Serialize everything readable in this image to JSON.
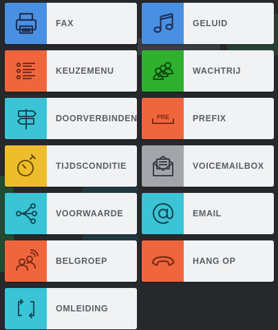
{
  "colors": {
    "blue": "#4a90e2",
    "orange": "#f0663c",
    "green": "#2fb12f",
    "teal": "#3bc3d6",
    "yellow": "#eebd2c",
    "gray": "#a3a5ab",
    "tile_bg": "#f1f2f3",
    "label": "#5b5e63"
  },
  "blocks": [
    {
      "label": "FAX",
      "icon": "fax-icon",
      "color": "blue"
    },
    {
      "label": "GELUID",
      "icon": "music-note-icon",
      "color": "blue"
    },
    {
      "label": "KEUZEMENU",
      "icon": "checklist-icon",
      "color": "orange"
    },
    {
      "label": "WACHTRIJ",
      "icon": "queue-people-icon",
      "color": "green"
    },
    {
      "label": "DOORVERBINDEN",
      "icon": "signpost-icon",
      "color": "teal"
    },
    {
      "label": "PREFIX",
      "icon": "prefix-icon",
      "prefix_badge": "PRE",
      "color": "orange"
    },
    {
      "label": "TIJDSCONDITIE",
      "icon": "stopwatch-icon",
      "color": "yellow"
    },
    {
      "label": "VOICEMAILBOX",
      "icon": "voicemail-envelope-icon",
      "color": "gray"
    },
    {
      "label": "VOORWAARDE",
      "icon": "branch-icon",
      "color": "teal"
    },
    {
      "label": "EMAIL",
      "icon": "at-sign-icon",
      "color": "teal"
    },
    {
      "label": "BELGROEP",
      "icon": "group-call-icon",
      "color": "orange"
    },
    {
      "label": "HANG OP",
      "icon": "hang-up-icon",
      "color": "orange"
    },
    {
      "label": "OMLEIDING",
      "icon": "redirect-icon",
      "color": "teal"
    }
  ]
}
